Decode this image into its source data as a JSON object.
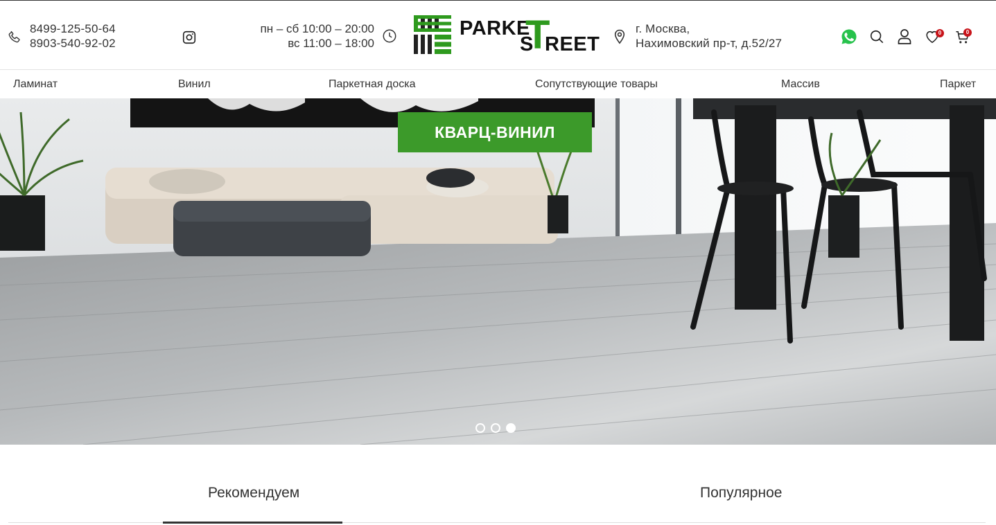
{
  "header": {
    "phones": [
      "8499-125-50-64",
      "8903-540-92-02"
    ],
    "hours": [
      "пн – сб 10:00 – 20:00",
      "вс 11:00 – 18:00"
    ],
    "logo": {
      "line1": "PARKE",
      "big_letter": "T",
      "line2": "S",
      "line2b": "REET"
    },
    "address": [
      "г. Москва,",
      "Нахимовский пр-т, д.52/27"
    ],
    "wishlist_count": "0",
    "cart_count": "0",
    "icons": [
      "phone-icon",
      "instagram-icon",
      "clock-icon",
      "location-pin-icon",
      "whatsapp-icon",
      "search-icon",
      "user-icon",
      "heart-icon",
      "cart-icon"
    ],
    "accent_color": "#3c9a2a"
  },
  "nav": {
    "items": [
      "Ламинат",
      "Винил",
      "Паркетная доска",
      "Сопутствующие товары",
      "Массив",
      "Паркет"
    ]
  },
  "hero": {
    "button_label": "КВАРЦ-ВИНИЛ",
    "slides_total": 3,
    "active_slide": 3
  },
  "tabs": {
    "items": [
      "Рекомендуем",
      "Популярное"
    ],
    "active": "Рекомендуем"
  }
}
